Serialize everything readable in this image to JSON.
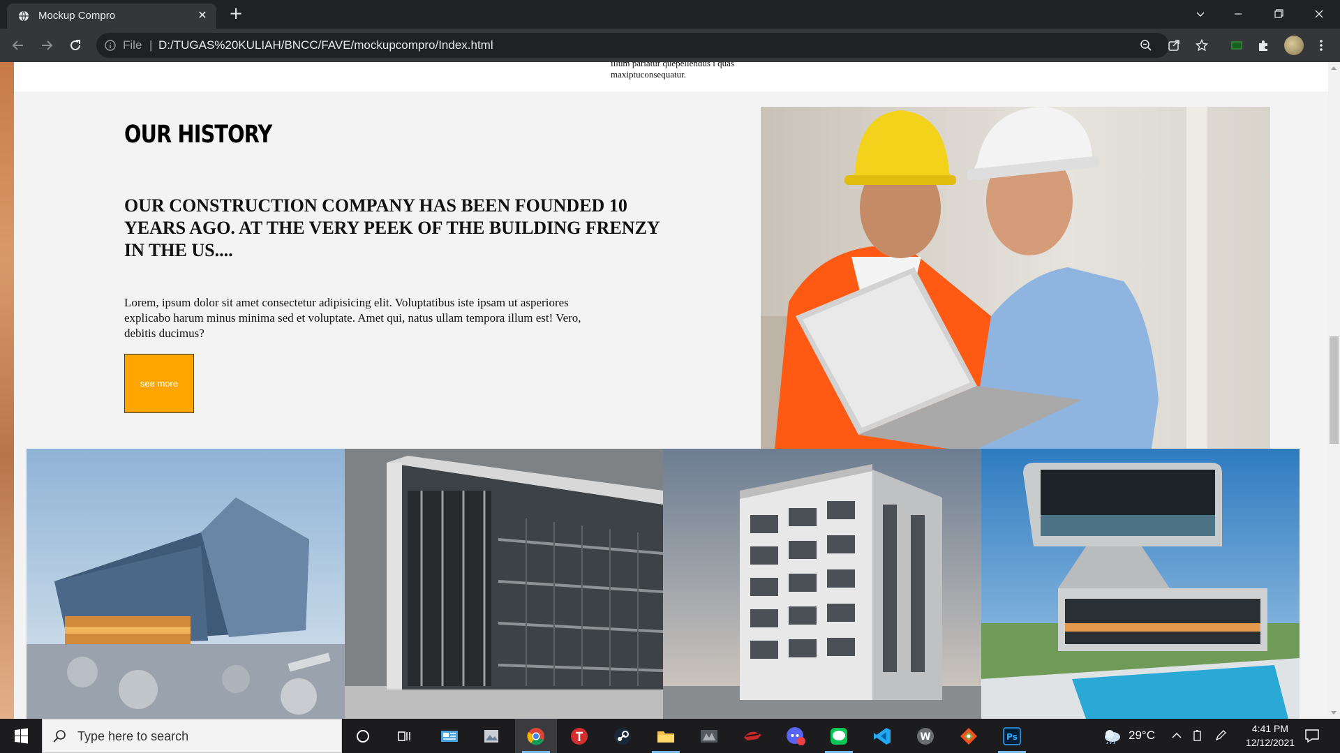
{
  "browser": {
    "tab_title": "Mockup Compro",
    "tab_close": "✕",
    "new_tab": "+",
    "address": {
      "scheme_label": "File",
      "separator": "|",
      "url": "D:/TUGAS%20KULIAH/BNCC/FAVE/mockupcompro/Index.html"
    }
  },
  "page": {
    "previous_section_text": "illum pariatur quepellendus i quas maxiptuconsequatur.",
    "history": {
      "title": "OUR HISTORY",
      "subtitle": "OUR CONSTRUCTION COMPANY HAS BEEN FOUNDED 10 YEARS AGO. AT THE VERY PEEK OF THE BUILDING FRENZY IN THE US....",
      "body": "Lorem, ipsum dolor sit amet consectetur adipisicing elit. Voluptatibus iste ipsam ut asperiores explicabo harum minus minima sed et voluptate. Amet qui, natus ullam tempora illum est! Vero, debitis ducimus?",
      "button_label": "see more",
      "button_color": "#ffa500",
      "photo": "two-engineers-with-laptop"
    },
    "gallery": [
      {
        "name": "glass-concert-hall"
      },
      {
        "name": "modern-office-building"
      },
      {
        "name": "white-apartment-tower"
      },
      {
        "name": "cantilever-house-with-pool"
      }
    ]
  },
  "taskbar": {
    "search_placeholder": "Type here to search",
    "apps": [
      "task-view",
      "widgets",
      "mail",
      "photos",
      "chrome",
      "app-t",
      "steam",
      "file-explorer",
      "media",
      "game",
      "discord",
      "line",
      "vscode",
      "word-app",
      "git-app",
      "photoshop"
    ],
    "temperature": "29°C",
    "time": "4:41 PM",
    "date": "12/12/2021"
  }
}
